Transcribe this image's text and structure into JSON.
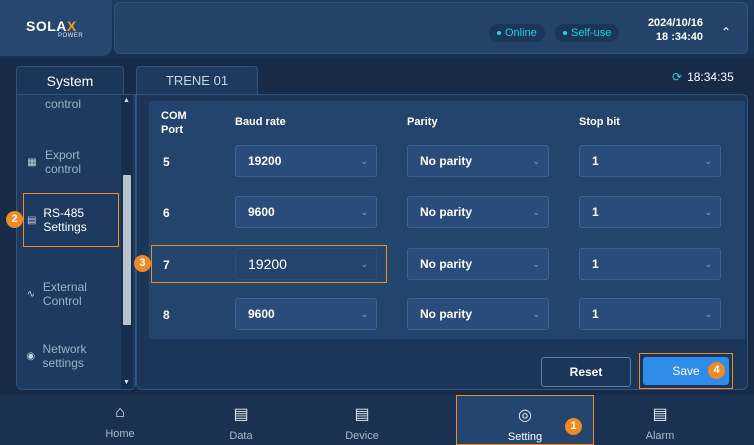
{
  "header": {
    "logo_main": "SOLA",
    "logo_x": "X",
    "logo_sub": "POWER",
    "status_online": "Online",
    "status_mode": "Self-use",
    "date": "2024/10/16",
    "time": "18 :34:40",
    "collapse_icon": "chevron-up-icon"
  },
  "left_tab": {
    "label": "System"
  },
  "sidebar": {
    "items": [
      {
        "label": "control",
        "icon": "control-icon"
      },
      {
        "label": "Export control",
        "icon": "export-icon"
      },
      {
        "label": "RS-485 Settings",
        "icon": "rs485-icon"
      },
      {
        "label": "External Control",
        "icon": "external-icon"
      },
      {
        "label": "Network settings",
        "icon": "globe-icon"
      }
    ]
  },
  "main": {
    "tab_label": "TRENE 01",
    "sync_time": "18:34:35",
    "columns": {
      "port": "COM Port",
      "baud": "Baud rate",
      "parity": "Parity",
      "stop": "Stop bit"
    },
    "rows": [
      {
        "port": "5",
        "baud": "19200",
        "parity": "No parity",
        "stop": "1"
      },
      {
        "port": "6",
        "baud": "9600",
        "parity": "No parity",
        "stop": "1"
      },
      {
        "port": "7",
        "baud": "19200",
        "parity": "No parity",
        "stop": "1"
      },
      {
        "port": "8",
        "baud": "9600",
        "parity": "No parity",
        "stop": "1"
      }
    ],
    "reset_label": "Reset",
    "save_label": "Save"
  },
  "annotations": {
    "b1": "1",
    "b2": "2",
    "b3": "3",
    "b4": "4"
  },
  "nav": {
    "items": [
      {
        "label": "Home",
        "icon": "home-icon"
      },
      {
        "label": "Data",
        "icon": "chart-icon"
      },
      {
        "label": "Device",
        "icon": "device-icon"
      },
      {
        "label": "Setting",
        "icon": "settings-icon"
      },
      {
        "label": "Alarm",
        "icon": "alarm-icon"
      }
    ]
  },
  "colors": {
    "accent_orange": "#f08a24",
    "save_blue": "#2f8ce8",
    "status_cyan": "#22d0e0"
  }
}
